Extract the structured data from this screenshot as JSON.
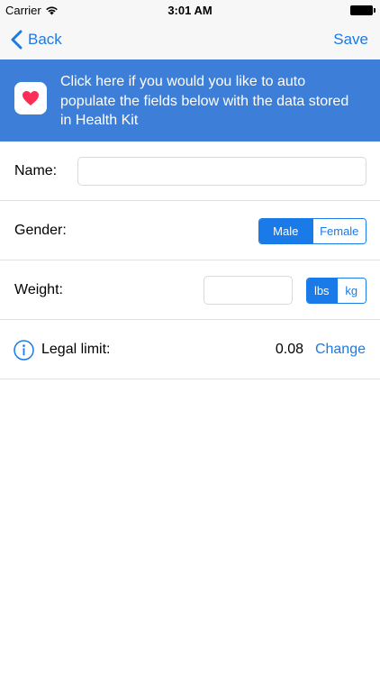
{
  "status_bar": {
    "carrier": "Carrier",
    "time": "3:01 AM",
    "wifi_icon": "wifi-icon",
    "battery_icon": "battery-icon"
  },
  "nav": {
    "back_label": "Back",
    "save_label": "Save",
    "back_icon": "chevron-left-icon"
  },
  "healthkit": {
    "icon": "heart-icon",
    "message": "Click here if you would you like to auto populate the fields below with the data stored in Health Kit"
  },
  "form": {
    "name": {
      "label": "Name:",
      "value": ""
    },
    "gender": {
      "label": "Gender:",
      "options": [
        "Male",
        "Female"
      ],
      "selected": "Male"
    },
    "weight": {
      "label": "Weight:",
      "value": "",
      "units": [
        "lbs",
        "kg"
      ],
      "selected_unit": "lbs"
    },
    "legal_limit": {
      "label": "Legal limit:",
      "value": "0.08",
      "change_label": "Change",
      "icon": "info-icon"
    }
  },
  "colors": {
    "accent": "#1a7ae8",
    "banner": "#3d7ed8",
    "heart": "#ff2d55",
    "separator": "#e1e1e1"
  }
}
